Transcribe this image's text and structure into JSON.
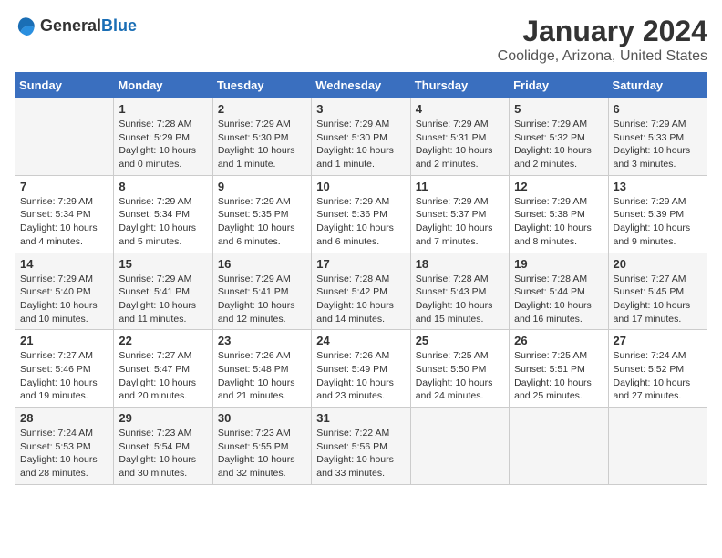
{
  "logo": {
    "general": "General",
    "blue": "Blue"
  },
  "title": "January 2024",
  "subtitle": "Coolidge, Arizona, United States",
  "headers": [
    "Sunday",
    "Monday",
    "Tuesday",
    "Wednesday",
    "Thursday",
    "Friday",
    "Saturday"
  ],
  "weeks": [
    [
      {
        "day": "",
        "info": ""
      },
      {
        "day": "1",
        "info": "Sunrise: 7:28 AM\nSunset: 5:29 PM\nDaylight: 10 hours\nand 0 minutes."
      },
      {
        "day": "2",
        "info": "Sunrise: 7:29 AM\nSunset: 5:30 PM\nDaylight: 10 hours\nand 1 minute."
      },
      {
        "day": "3",
        "info": "Sunrise: 7:29 AM\nSunset: 5:30 PM\nDaylight: 10 hours\nand 1 minute."
      },
      {
        "day": "4",
        "info": "Sunrise: 7:29 AM\nSunset: 5:31 PM\nDaylight: 10 hours\nand 2 minutes."
      },
      {
        "day": "5",
        "info": "Sunrise: 7:29 AM\nSunset: 5:32 PM\nDaylight: 10 hours\nand 2 minutes."
      },
      {
        "day": "6",
        "info": "Sunrise: 7:29 AM\nSunset: 5:33 PM\nDaylight: 10 hours\nand 3 minutes."
      }
    ],
    [
      {
        "day": "7",
        "info": "Sunrise: 7:29 AM\nSunset: 5:34 PM\nDaylight: 10 hours\nand 4 minutes."
      },
      {
        "day": "8",
        "info": "Sunrise: 7:29 AM\nSunset: 5:34 PM\nDaylight: 10 hours\nand 5 minutes."
      },
      {
        "day": "9",
        "info": "Sunrise: 7:29 AM\nSunset: 5:35 PM\nDaylight: 10 hours\nand 6 minutes."
      },
      {
        "day": "10",
        "info": "Sunrise: 7:29 AM\nSunset: 5:36 PM\nDaylight: 10 hours\nand 6 minutes."
      },
      {
        "day": "11",
        "info": "Sunrise: 7:29 AM\nSunset: 5:37 PM\nDaylight: 10 hours\nand 7 minutes."
      },
      {
        "day": "12",
        "info": "Sunrise: 7:29 AM\nSunset: 5:38 PM\nDaylight: 10 hours\nand 8 minutes."
      },
      {
        "day": "13",
        "info": "Sunrise: 7:29 AM\nSunset: 5:39 PM\nDaylight: 10 hours\nand 9 minutes."
      }
    ],
    [
      {
        "day": "14",
        "info": "Sunrise: 7:29 AM\nSunset: 5:40 PM\nDaylight: 10 hours\nand 10 minutes."
      },
      {
        "day": "15",
        "info": "Sunrise: 7:29 AM\nSunset: 5:41 PM\nDaylight: 10 hours\nand 11 minutes."
      },
      {
        "day": "16",
        "info": "Sunrise: 7:29 AM\nSunset: 5:41 PM\nDaylight: 10 hours\nand 12 minutes."
      },
      {
        "day": "17",
        "info": "Sunrise: 7:28 AM\nSunset: 5:42 PM\nDaylight: 10 hours\nand 14 minutes."
      },
      {
        "day": "18",
        "info": "Sunrise: 7:28 AM\nSunset: 5:43 PM\nDaylight: 10 hours\nand 15 minutes."
      },
      {
        "day": "19",
        "info": "Sunrise: 7:28 AM\nSunset: 5:44 PM\nDaylight: 10 hours\nand 16 minutes."
      },
      {
        "day": "20",
        "info": "Sunrise: 7:27 AM\nSunset: 5:45 PM\nDaylight: 10 hours\nand 17 minutes."
      }
    ],
    [
      {
        "day": "21",
        "info": "Sunrise: 7:27 AM\nSunset: 5:46 PM\nDaylight: 10 hours\nand 19 minutes."
      },
      {
        "day": "22",
        "info": "Sunrise: 7:27 AM\nSunset: 5:47 PM\nDaylight: 10 hours\nand 20 minutes."
      },
      {
        "day": "23",
        "info": "Sunrise: 7:26 AM\nSunset: 5:48 PM\nDaylight: 10 hours\nand 21 minutes."
      },
      {
        "day": "24",
        "info": "Sunrise: 7:26 AM\nSunset: 5:49 PM\nDaylight: 10 hours\nand 23 minutes."
      },
      {
        "day": "25",
        "info": "Sunrise: 7:25 AM\nSunset: 5:50 PM\nDaylight: 10 hours\nand 24 minutes."
      },
      {
        "day": "26",
        "info": "Sunrise: 7:25 AM\nSunset: 5:51 PM\nDaylight: 10 hours\nand 25 minutes."
      },
      {
        "day": "27",
        "info": "Sunrise: 7:24 AM\nSunset: 5:52 PM\nDaylight: 10 hours\nand 27 minutes."
      }
    ],
    [
      {
        "day": "28",
        "info": "Sunrise: 7:24 AM\nSunset: 5:53 PM\nDaylight: 10 hours\nand 28 minutes."
      },
      {
        "day": "29",
        "info": "Sunrise: 7:23 AM\nSunset: 5:54 PM\nDaylight: 10 hours\nand 30 minutes."
      },
      {
        "day": "30",
        "info": "Sunrise: 7:23 AM\nSunset: 5:55 PM\nDaylight: 10 hours\nand 32 minutes."
      },
      {
        "day": "31",
        "info": "Sunrise: 7:22 AM\nSunset: 5:56 PM\nDaylight: 10 hours\nand 33 minutes."
      },
      {
        "day": "",
        "info": ""
      },
      {
        "day": "",
        "info": ""
      },
      {
        "day": "",
        "info": ""
      }
    ]
  ]
}
